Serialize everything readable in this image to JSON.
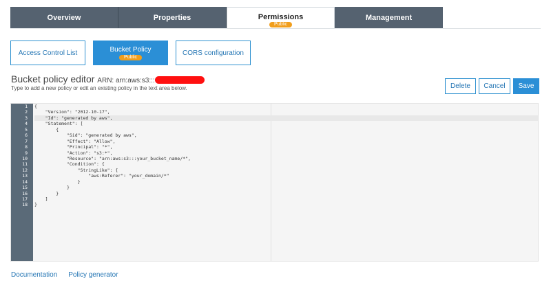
{
  "tabs": [
    {
      "label": "Overview"
    },
    {
      "label": "Properties"
    },
    {
      "label": "Permissions",
      "badge": "Public"
    },
    {
      "label": "Management"
    }
  ],
  "subtabs": [
    {
      "label": "Access Control List"
    },
    {
      "label": "Bucket Policy",
      "badge": "Public"
    },
    {
      "label": "CORS configuration"
    }
  ],
  "editor_header": {
    "title": "Bucket policy editor",
    "arn": "ARN: arn:aws:s3:::",
    "description": "Type to add a new policy or edit an existing policy in the text area below."
  },
  "actions": {
    "delete": "Delete",
    "cancel": "Cancel",
    "save": "Save"
  },
  "code_lines": [
    "{",
    "    \"Version\": \"2012-10-17\",",
    "    \"Id\": \"generated by aws\",",
    "    \"Statement\": [",
    "        {",
    "            \"Sid\": \"generated by aws\",",
    "            \"Effect\": \"Allow\",",
    "            \"Principal\": \"*\",",
    "            \"Action\": \"s3:*\",",
    "            \"Resource\": \"arn:aws:s3:::your_bucket_name/*\",",
    "            \"Condition\": {",
    "                \"StringLike\": {",
    "                    \"aws:Referer\": \"your_domain/*\"",
    "                }",
    "            }",
    "        }",
    "    ]",
    "}"
  ],
  "line_numbers": [
    "1",
    "2",
    "3",
    "4",
    "5",
    "6",
    "7",
    "8",
    "9",
    "10",
    "11",
    "12",
    "13",
    "14",
    "15",
    "16",
    "17",
    "18"
  ],
  "footer": {
    "documentation": "Documentation",
    "policy_generator": "Policy generator"
  },
  "colors": {
    "tab_bg": "#556270",
    "accent": "#2b8fd6",
    "badge": "#f19e1c",
    "redaction": "#ff1010"
  }
}
